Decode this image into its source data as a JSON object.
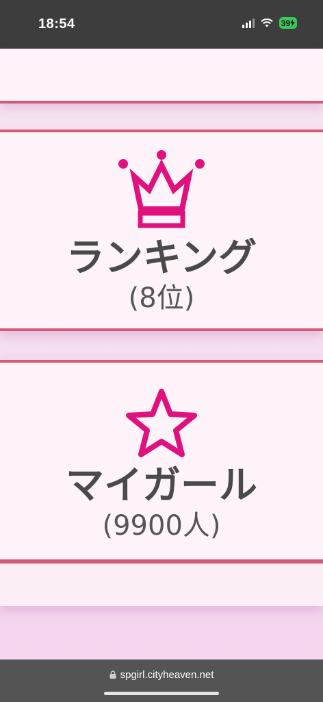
{
  "status_bar": {
    "time": "18:54",
    "battery": "39"
  },
  "ranking": {
    "title": "ランキング",
    "subtitle": "(8位)"
  },
  "mygirl": {
    "title": "マイガール",
    "subtitle": "(9900人)"
  },
  "browser": {
    "url": "spgirl.cityheaven.net"
  },
  "colors": {
    "accent": "#e0107e",
    "divider": "#d45a78",
    "text": "#4a4a4a"
  },
  "icons": {
    "ranking": "crown-icon",
    "mygirl": "star-icon"
  }
}
